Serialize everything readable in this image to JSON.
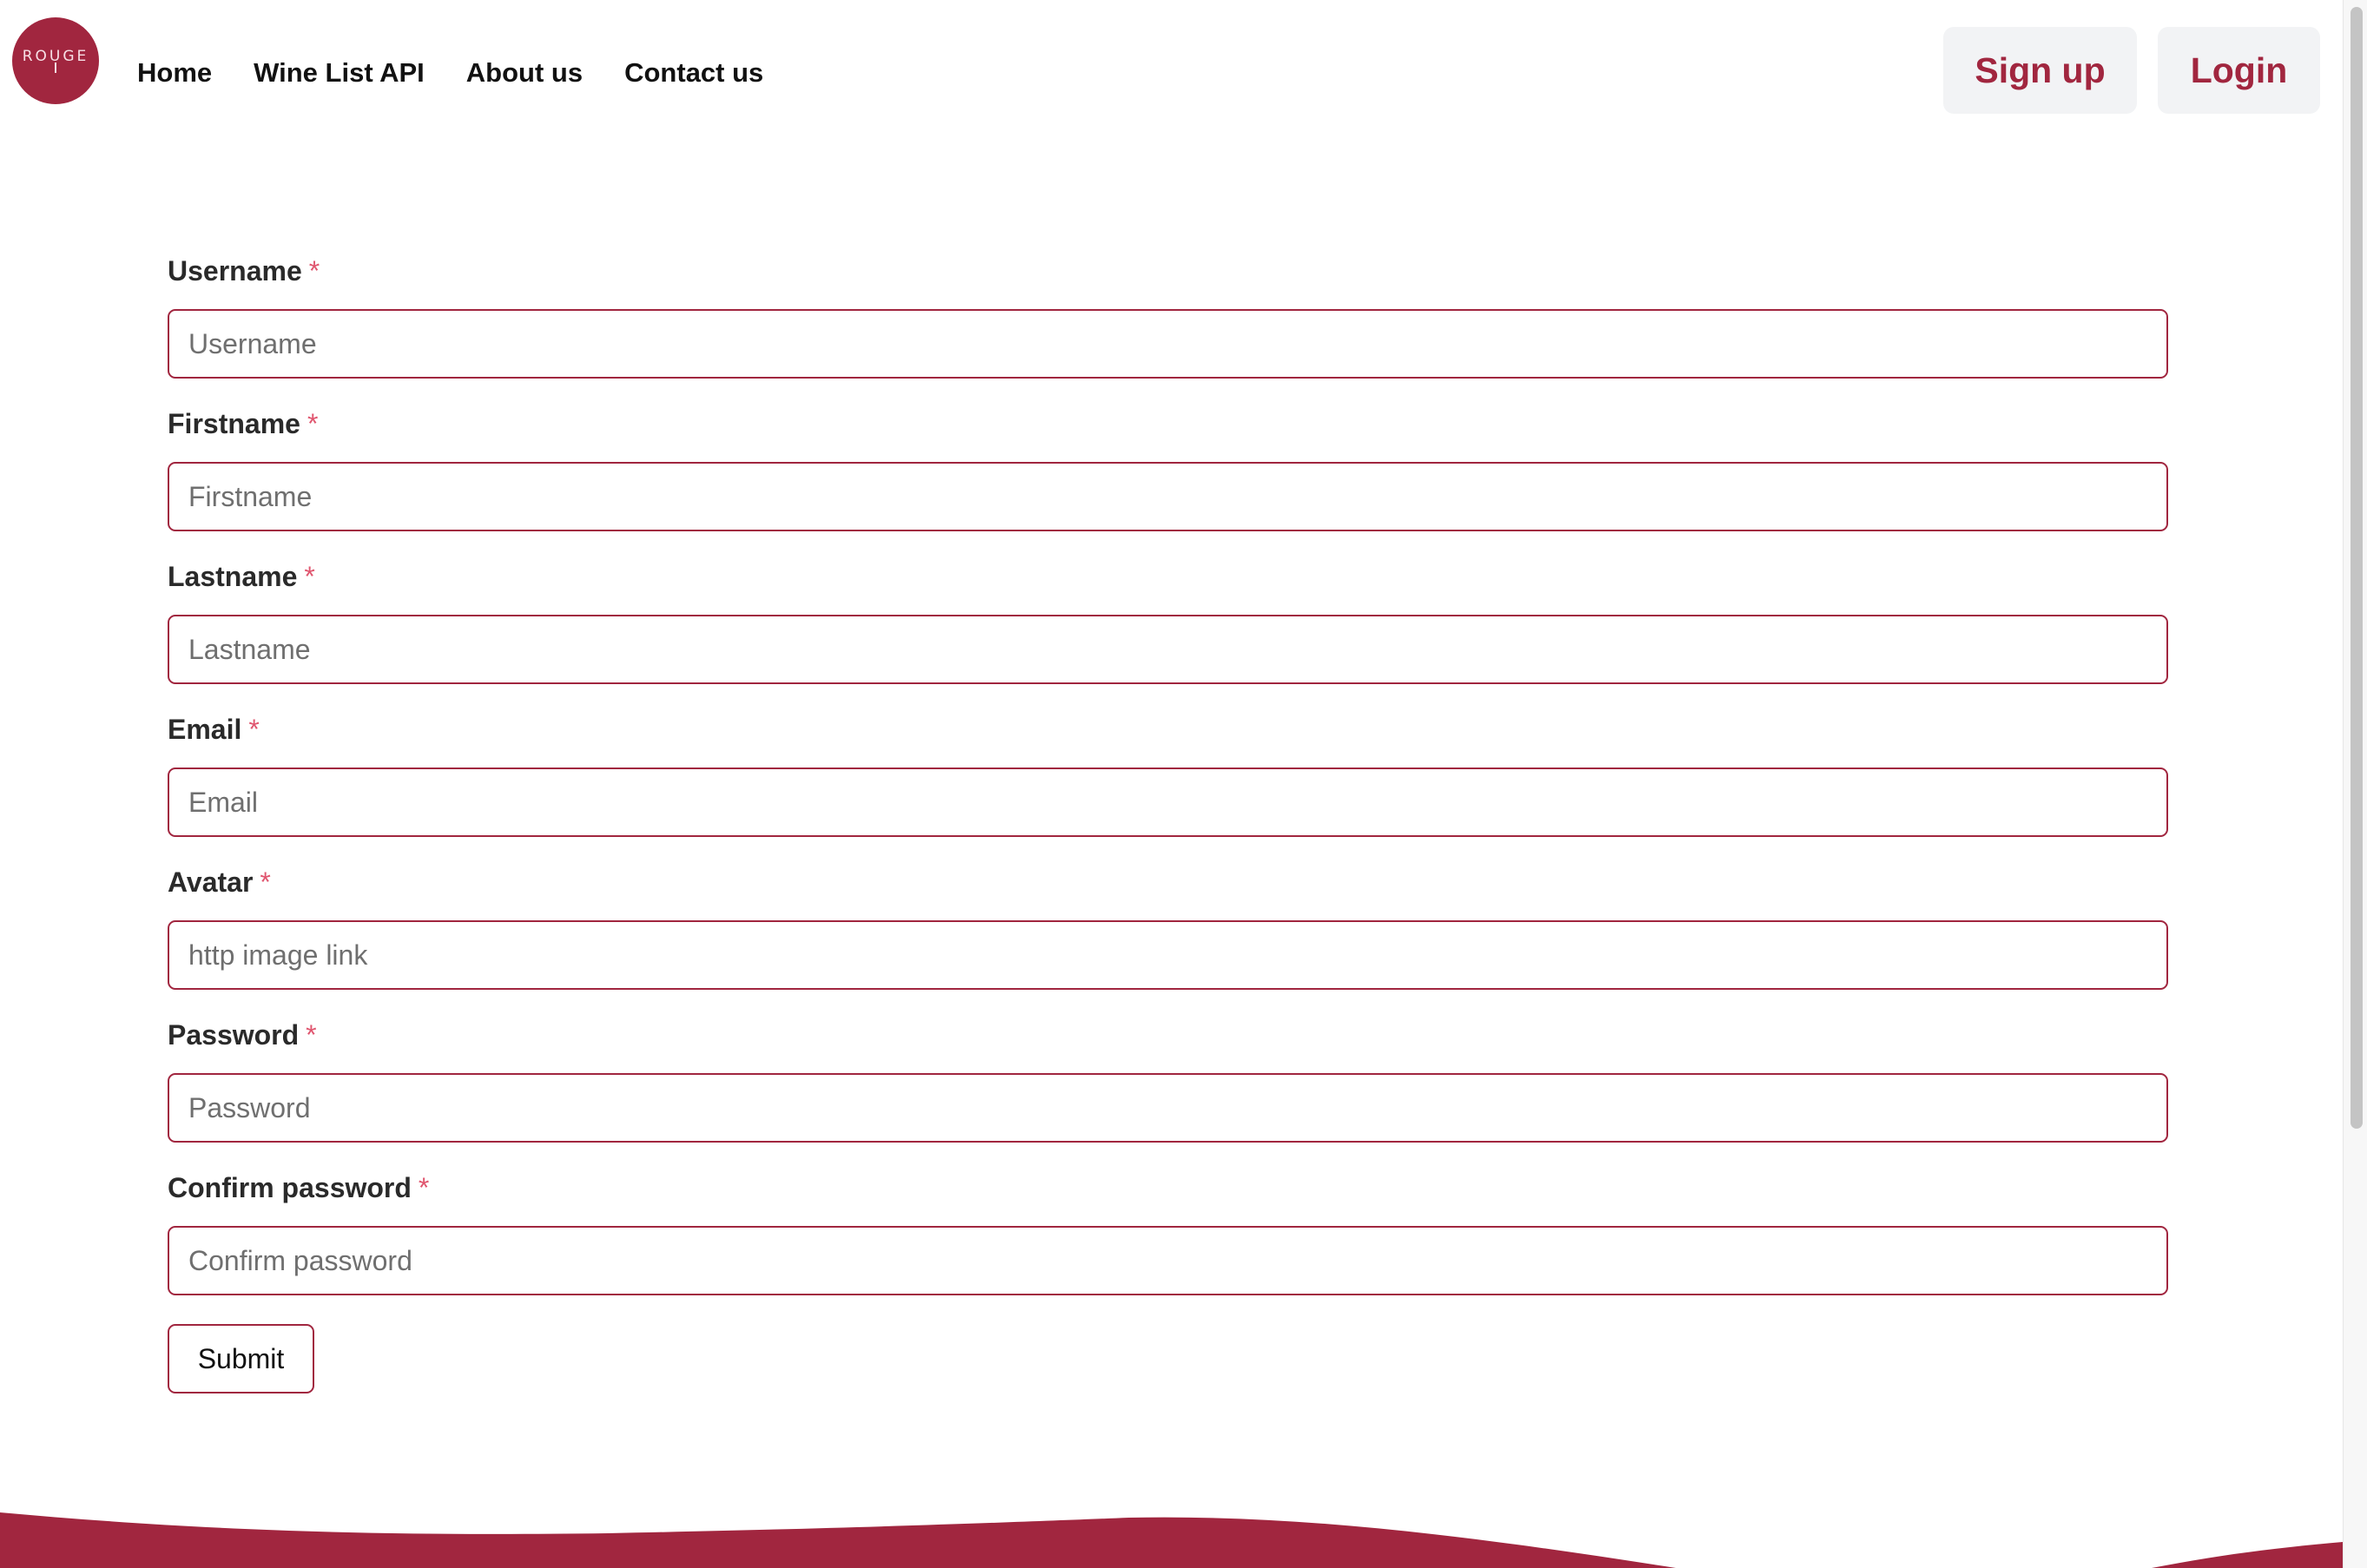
{
  "header": {
    "logo_text": "ROUGE",
    "nav": [
      {
        "label": "Home"
      },
      {
        "label": "Wine List API"
      },
      {
        "label": "About us"
      },
      {
        "label": "Contact us"
      }
    ],
    "signup_label": "Sign up",
    "login_label": "Login"
  },
  "form": {
    "required_mark": "*",
    "fields": [
      {
        "label": "Username",
        "placeholder": "Username"
      },
      {
        "label": "Firstname",
        "placeholder": "Firstname"
      },
      {
        "label": "Lastname",
        "placeholder": "Lastname"
      },
      {
        "label": "Email",
        "placeholder": "Email"
      },
      {
        "label": "Avatar",
        "placeholder": "http image link"
      },
      {
        "label": "Password",
        "placeholder": "Password"
      },
      {
        "label": "Confirm password",
        "placeholder": "Confirm password"
      }
    ],
    "submit_label": "Submit"
  },
  "colors": {
    "brand": "#a1263f",
    "required": "#e0566f",
    "auth_button_bg": "#f2f3f5"
  }
}
